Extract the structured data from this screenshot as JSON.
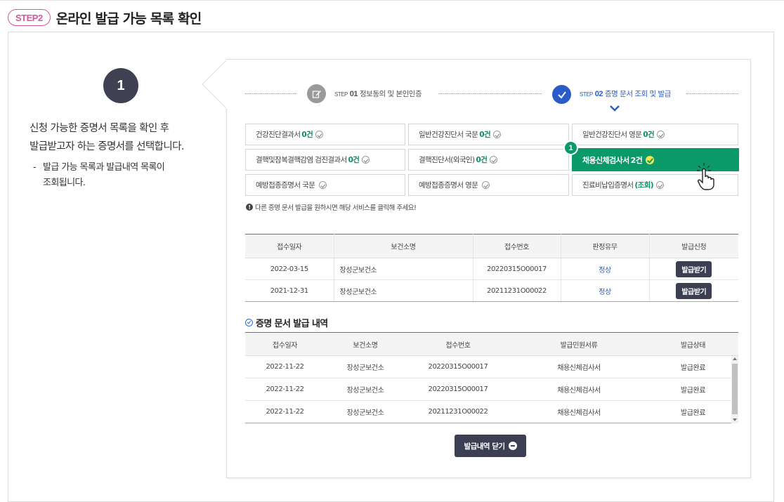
{
  "header": {
    "step_pill": "STEP2",
    "title": "온라인 발급 가능 목록 확인"
  },
  "left": {
    "badge": "1",
    "desc_line1": "신청 가능한 증명서 목록을 확인 후",
    "desc_line2": "발급받고자 하는 증명서를 선택합니다.",
    "sub_dash": "-",
    "sub_line1": "발급 가능 목록과 발급내역 목록이",
    "sub_line2": "조회됩니다."
  },
  "steps": [
    {
      "small": "STEP",
      "num": "01",
      "label": "정보동의 및 본인인증",
      "icon": "edit-icon",
      "color": "#9a9a9a"
    },
    {
      "small": "STEP",
      "num": "02",
      "label": "증명 문서 조회 및 발급",
      "icon": "check-icon",
      "color": "#2a5bc8"
    }
  ],
  "certs": [
    {
      "name": "건강진단결과서",
      "count": "0건"
    },
    {
      "name": "일반건강진단서 국문",
      "count": "0건"
    },
    {
      "name": "일반건강진단서 영문",
      "count": "0건"
    },
    {
      "name": "결핵및잠복결핵감염 검진결과서",
      "count": "0건"
    },
    {
      "name": "결핵진단서(외국인)",
      "count": "0건"
    },
    {
      "name": "채용신체검사서",
      "count": "2건"
    },
    {
      "name": "예방접종증명서 국문",
      "count": ""
    },
    {
      "name": "예방접종증명서 영문",
      "count": ""
    },
    {
      "name": "진료비납입증명서",
      "count": "(조회)"
    }
  ],
  "marker": "1",
  "notice": "다른 증명 문서 발급을 원하시면 해당 서비스를 클릭해 주세요!",
  "issue_table": {
    "headers": [
      "접수일자",
      "보건소명",
      "접수번호",
      "판정유무",
      "발급신청"
    ],
    "rows": [
      {
        "date": "2022-03-15",
        "center": "장성군보건소",
        "no": "20220315O00017",
        "result": "정상",
        "btn": "발급받기"
      },
      {
        "date": "2021-12-31",
        "center": "장성군보건소",
        "no": "20211231O00022",
        "result": "정상",
        "btn": "발급받기"
      }
    ]
  },
  "history": {
    "title": "증명 문서 발급 내역",
    "headers": [
      "접수일자",
      "보건소명",
      "접수번호",
      "발급민원서류",
      "발급상태"
    ],
    "rows": [
      {
        "date": "2022-11-22",
        "center": "장성군보건소",
        "no": "20220315O00017",
        "doc": "채용신체검사서",
        "status": "발급완료"
      },
      {
        "date": "2022-11-22",
        "center": "장성군보건소",
        "no": "20220315O00017",
        "doc": "채용신체검사서",
        "status": "발급완료"
      },
      {
        "date": "2022-11-22",
        "center": "장성군보건소",
        "no": "20211231O00022",
        "doc": "채용신체검사서",
        "status": "발급완료"
      }
    ]
  },
  "close_button": "발급내역 닫기",
  "colors": {
    "accent_green": "#0a9a6a",
    "step_pill": "#d9559c",
    "dark_button": "#3c3e52",
    "step_blue": "#2a5bc8"
  }
}
